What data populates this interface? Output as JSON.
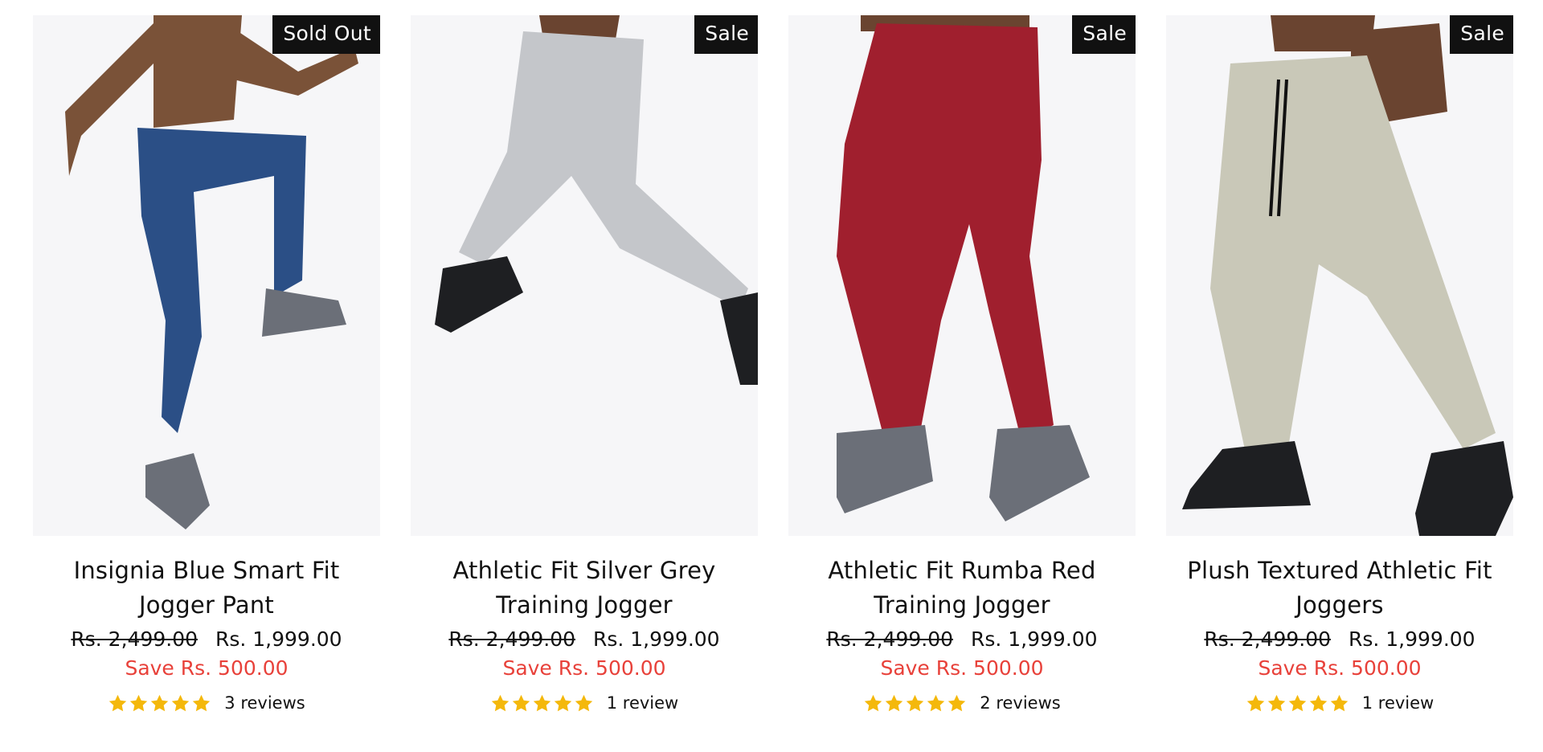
{
  "colors": {
    "badge_bg": "#111111",
    "save_text": "#e8413a",
    "star": "#f4b80b"
  },
  "products": [
    {
      "badge": "Sold Out",
      "title": "Insignia Blue Smart Fit Jogger Pant",
      "old_price": "Rs. 2,499.00",
      "price": "Rs. 1,999.00",
      "save": "Save Rs. 500.00",
      "rating": 5,
      "reviews": "3 reviews",
      "pant_color": "#2b4f86",
      "shoe_color": "#6b6f78"
    },
    {
      "badge": "Sale",
      "title": "Athletic Fit Silver Grey Training Jogger",
      "old_price": "Rs. 2,499.00",
      "price": "Rs. 1,999.00",
      "save": "Save Rs. 500.00",
      "rating": 5,
      "reviews": "1 review",
      "pant_color": "#c4c6ca",
      "shoe_color": "#1e1f22"
    },
    {
      "badge": "Sale",
      "title": "Athletic Fit Rumba Red Training Jogger",
      "old_price": "Rs. 2,499.00",
      "price": "Rs. 1,999.00",
      "save": "Save Rs. 500.00",
      "rating": 5,
      "reviews": "2 reviews",
      "pant_color": "#a01f2e",
      "shoe_color": "#6b6f78"
    },
    {
      "badge": "Sale",
      "title": "Plush Textured Athletic Fit Joggers",
      "old_price": "Rs. 2,499.00",
      "price": "Rs. 1,999.00",
      "save": "Save Rs. 500.00",
      "rating": 5,
      "reviews": "1 review",
      "pant_color": "#c9c8b8",
      "shoe_color": "#1e1f22"
    }
  ]
}
